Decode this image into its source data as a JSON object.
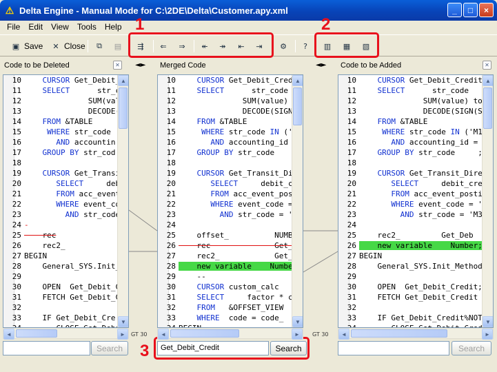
{
  "window": {
    "title": "Delta Engine - Manual Mode for C:\\2DE\\Delta\\Customer.apy.xml",
    "min": "_",
    "max": "□",
    "close": "×"
  },
  "menu": [
    "File",
    "Edit",
    "View",
    "Tools",
    "Help"
  ],
  "toolbar": {
    "save_label": "Save",
    "close_label": "Close"
  },
  "annotations": [
    "1",
    "2",
    "3"
  ],
  "panes": {
    "left": {
      "title": "Code to be Deleted",
      "search_placeholder": "",
      "search_button": "Search"
    },
    "middle": {
      "title": "Merged Code",
      "search_value": "Get_Debit_Credit",
      "search_button": "Search"
    },
    "right": {
      "title": "Code to be Added",
      "search_placeholder": "",
      "search_button": "Search"
    }
  },
  "swap_arrows": "◄►",
  "mini_label": "GT 30",
  "left_lines": [
    [
      "10",
      "    CURSOR Get_Debit_Cre"
    ],
    [
      "11",
      "    SELECT      str_co"
    ],
    [
      "12",
      "              SUM(value"
    ],
    [
      "13",
      "              DECODE(SIG"
    ],
    [
      "14",
      "    FROM &TABLE"
    ],
    [
      "15",
      "     WHERE str_code"
    ],
    [
      "16",
      "       AND accountin"
    ],
    [
      "17",
      "    GROUP BY str_cod"
    ],
    [
      "18",
      ""
    ],
    [
      "19",
      "    CURSOR Get_Transi"
    ],
    [
      "20",
      "       SELECT     deb"
    ],
    [
      "21",
      "       FROM acc_event"
    ],
    [
      "22",
      "       WHERE event_co"
    ],
    [
      "23",
      "         AND str_code"
    ],
    [
      "24",
      "-"
    ],
    [
      "25",
      "    rec"
    ],
    [
      "26",
      "    rec2_"
    ],
    [
      "27",
      "BEGIN"
    ],
    [
      "28",
      "    General_SYS.Init_"
    ],
    [
      "29",
      ""
    ],
    [
      "30",
      "    OPEN  Get_Debit_C"
    ],
    [
      "31",
      "    FETCH Get_Debit_C"
    ],
    [
      "32",
      ""
    ],
    [
      "33",
      "    IF Get_Debit_Cre"
    ],
    [
      "34",
      "       CLOSE Get_Debi"
    ]
  ],
  "middle_lines": [
    [
      "10",
      "    CURSOR Get_Debit_Credit"
    ],
    [
      "11",
      "    SELECT      str_code"
    ],
    [
      "12",
      "              SUM(value) tot"
    ],
    [
      "13",
      "              DECODE(SIGN(SUM"
    ],
    [
      "14",
      "    FROM &TABLE"
    ],
    [
      "15",
      "     WHERE str_code IN ('"
    ],
    [
      "16",
      "       AND accounting_id"
    ],
    [
      "17",
      "    GROUP BY str_code"
    ],
    [
      "18",
      ""
    ],
    [
      "19",
      "    CURSOR Get_Transit_Di"
    ],
    [
      "20",
      "       SELECT     debit_c"
    ],
    [
      "21",
      "       FROM acc_event_pos"
    ],
    [
      "22",
      "       WHERE event_code ="
    ],
    [
      "23",
      "         AND str_code = '"
    ],
    [
      "24",
      ""
    ],
    [
      "25",
      "    offset_          NUMBER"
    ],
    [
      "26",
      "    rec              Get_D"
    ],
    [
      "27",
      "    rec2_            Get_I"
    ],
    [
      "28",
      "    new variable    Numbe"
    ],
    [
      "29",
      "    --"
    ],
    [
      "30",
      "    CURSOR custom_calc"
    ],
    [
      "31",
      "    SELECT     factor * c"
    ],
    [
      "32",
      "    FROM   &OFFSET_VIEW"
    ],
    [
      "33",
      "    WHERE  code = code_"
    ],
    [
      "34",
      "BEGIN"
    ]
  ],
  "right_lines": [
    [
      "10",
      "    CURSOR Get_Debit_Credit"
    ],
    [
      "11",
      "    SELECT      str_code"
    ],
    [
      "12",
      "              SUM(value) total"
    ],
    [
      "13",
      "              DECODE(SIGN(SUM(v"
    ],
    [
      "14",
      "    FROM &TABLE"
    ],
    [
      "15",
      "     WHERE str_code IN ('M1"
    ],
    [
      "16",
      "       AND accounting_id ="
    ],
    [
      "17",
      "    GROUP BY str_code     ;"
    ],
    [
      "18",
      ""
    ],
    [
      "19",
      "    CURSOR Get_Transit_Dire"
    ],
    [
      "20",
      "       SELECT     debit_cre"
    ],
    [
      "21",
      "       FROM acc_event_posti"
    ],
    [
      "22",
      "       WHERE event_code = '"
    ],
    [
      "23",
      "         AND str_code = 'M3"
    ],
    [
      "24",
      ""
    ],
    [
      "25",
      "    rec2_         Get_Deb"
    ],
    [
      "26",
      "    new variable    Number;"
    ],
    [
      "27",
      "BEGIN"
    ],
    [
      "28",
      "    General_SYS.Init_Method"
    ],
    [
      "29",
      ""
    ],
    [
      "30",
      "    OPEN  Get_Debit_Credit;"
    ],
    [
      "31",
      "    FETCH Get_Debit_Credit I"
    ],
    [
      "32",
      ""
    ],
    [
      "33",
      "    IF Get_Debit_Credit%NOTF"
    ],
    [
      "34",
      "       CLOSE Get_Debit_Cred"
    ]
  ]
}
